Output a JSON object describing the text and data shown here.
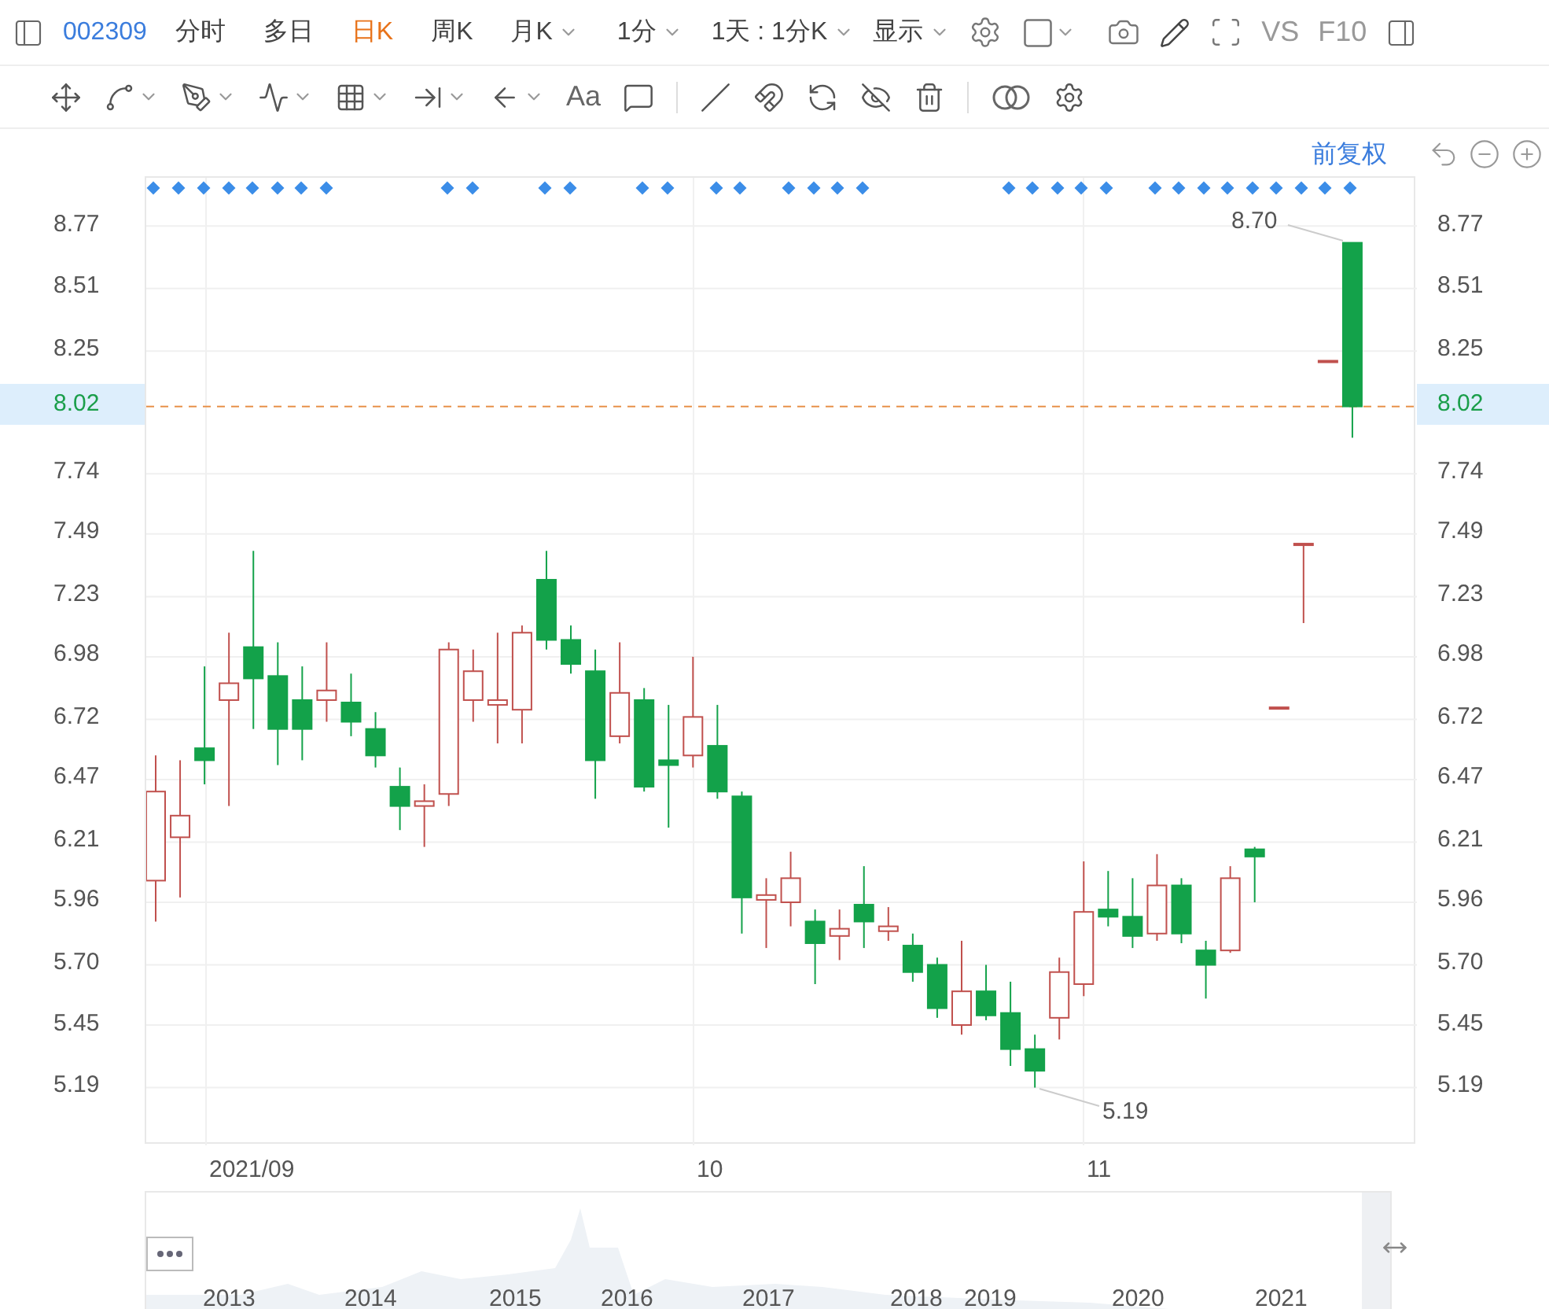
{
  "toolbar": {
    "code": "002309",
    "periods": [
      {
        "label": "分时",
        "selected": false,
        "dropdown": false
      },
      {
        "label": "多日",
        "selected": false,
        "dropdown": false
      },
      {
        "label": "日K",
        "selected": true,
        "dropdown": false
      },
      {
        "label": "周K",
        "selected": false,
        "dropdown": false
      },
      {
        "label": "月K",
        "selected": false,
        "dropdown": true
      },
      {
        "label": "1分",
        "selected": false,
        "dropdown": true
      }
    ],
    "range": "1天 : 1分K",
    "display": "显示",
    "compare": "VS",
    "f10": "F10"
  },
  "drawing_tools": {
    "text_tool": "Aa"
  },
  "chart": {
    "adjustment": "前复权",
    "right_axis": [
      "8.77",
      "8.51",
      "8.25",
      "7.74",
      "7.49",
      "7.23",
      "6.98",
      "6.72",
      "6.47",
      "6.21",
      "5.96",
      "5.70",
      "5.45",
      "5.19"
    ],
    "right_current_price": "8.02",
    "high_label": "8.70",
    "low_label": "5.19",
    "dates": [
      "2021/09",
      "10",
      "11"
    ],
    "chart_data": {
      "type": "candlestick",
      "ylim": [
        4.95,
        8.97
      ],
      "grid": true,
      "ref_lines": [
        {
          "axis": "y",
          "value": 8.02,
          "label": "8.02"
        }
      ],
      "yticks": [
        {
          "value": 8.77,
          "label": "8.77"
        },
        {
          "value": 8.51,
          "label": "8.51"
        },
        {
          "value": 8.25,
          "label": "8.25"
        },
        {
          "value": 7.74,
          "label": "7.74"
        },
        {
          "value": 7.49,
          "label": "7.49"
        },
        {
          "value": 7.23,
          "label": "7.23"
        },
        {
          "value": 6.98,
          "label": "6.98"
        },
        {
          "value": 6.72,
          "label": "6.72"
        },
        {
          "value": 6.47,
          "label": "6.47"
        },
        {
          "value": 6.21,
          "label": "6.21"
        },
        {
          "value": 5.96,
          "label": "5.96"
        },
        {
          "value": 5.7,
          "label": "5.70"
        },
        {
          "value": 5.45,
          "label": "5.45"
        },
        {
          "value": 5.19,
          "label": "5.19"
        }
      ],
      "categories": [
        null,
        null,
        null,
        null,
        null,
        null,
        null,
        null,
        null,
        null,
        null,
        null,
        null,
        null,
        null,
        null,
        null,
        null,
        null,
        null,
        null,
        null,
        null,
        null,
        null,
        null,
        null,
        null,
        null,
        null,
        null,
        null,
        null,
        null,
        null,
        null,
        null,
        null,
        null,
        null,
        null,
        null,
        null,
        null,
        null,
        null,
        null,
        null,
        null,
        null
      ],
      "ohlc": [
        [
          6.05,
          6.57,
          5.88,
          6.42
        ],
        [
          6.23,
          6.55,
          5.98,
          6.32
        ],
        [
          6.6,
          6.94,
          6.45,
          6.55
        ],
        [
          6.8,
          7.08,
          6.36,
          6.87
        ],
        [
          7.02,
          7.42,
          6.68,
          6.89
        ],
        [
          6.9,
          7.04,
          6.53,
          6.68
        ],
        [
          6.8,
          6.94,
          6.55,
          6.68
        ],
        [
          6.8,
          7.04,
          6.71,
          6.84
        ],
        [
          6.79,
          6.91,
          6.65,
          6.71
        ],
        [
          6.68,
          6.75,
          6.52,
          6.57
        ],
        [
          6.44,
          6.52,
          6.26,
          6.36
        ],
        [
          6.36,
          6.45,
          6.19,
          6.38
        ],
        [
          6.41,
          7.04,
          6.36,
          7.01
        ],
        [
          6.8,
          7.01,
          6.71,
          6.92
        ],
        [
          6.78,
          7.08,
          6.62,
          6.8
        ],
        [
          6.76,
          7.11,
          6.62,
          7.08
        ],
        [
          7.3,
          7.42,
          7.01,
          7.05
        ],
        [
          7.05,
          7.11,
          6.91,
          6.95
        ],
        [
          6.92,
          7.01,
          6.39,
          6.55
        ],
        [
          6.65,
          7.04,
          6.62,
          6.83
        ],
        [
          6.8,
          6.85,
          6.42,
          6.44
        ],
        [
          6.55,
          6.78,
          6.27,
          6.53
        ],
        [
          6.57,
          6.98,
          6.52,
          6.73
        ],
        [
          6.61,
          6.78,
          6.39,
          6.42
        ],
        [
          6.4,
          6.42,
          5.83,
          5.98
        ],
        [
          5.97,
          6.06,
          5.77,
          5.99
        ],
        [
          5.96,
          6.17,
          5.86,
          6.06
        ],
        [
          5.88,
          5.93,
          5.62,
          5.79
        ],
        [
          5.82,
          5.93,
          5.72,
          5.85
        ],
        [
          5.95,
          6.11,
          5.77,
          5.88
        ],
        [
          5.84,
          5.94,
          5.8,
          5.86
        ],
        [
          5.78,
          5.83,
          5.63,
          5.67
        ],
        [
          5.7,
          5.73,
          5.48,
          5.52
        ],
        [
          5.45,
          5.8,
          5.41,
          5.59
        ],
        [
          5.59,
          5.7,
          5.47,
          5.49
        ],
        [
          5.5,
          5.63,
          5.28,
          5.35
        ],
        [
          5.35,
          5.41,
          5.19,
          5.26
        ],
        [
          5.48,
          5.73,
          5.39,
          5.67
        ],
        [
          5.62,
          6.13,
          5.57,
          5.92
        ],
        [
          5.93,
          6.09,
          5.86,
          5.9
        ],
        [
          5.9,
          6.06,
          5.77,
          5.82
        ],
        [
          5.83,
          6.16,
          5.8,
          6.03
        ],
        [
          6.03,
          6.06,
          5.79,
          5.83
        ],
        [
          5.76,
          5.8,
          5.56,
          5.7
        ],
        [
          5.76,
          6.11,
          5.75,
          6.06
        ],
        [
          6.18,
          6.19,
          5.96,
          6.15
        ],
        [
          6.77,
          6.77,
          6.77,
          6.77
        ],
        [
          7.45,
          7.45,
          7.12,
          7.45
        ],
        [
          8.21,
          8.21,
          8.21,
          8.21
        ],
        [
          8.7,
          8.7,
          7.89,
          8.02
        ]
      ]
    }
  },
  "navigator": {
    "years": [
      "2013",
      "2014",
      "2015",
      "2016",
      "2017",
      "2018",
      "2019",
      "2020",
      "2021"
    ]
  }
}
